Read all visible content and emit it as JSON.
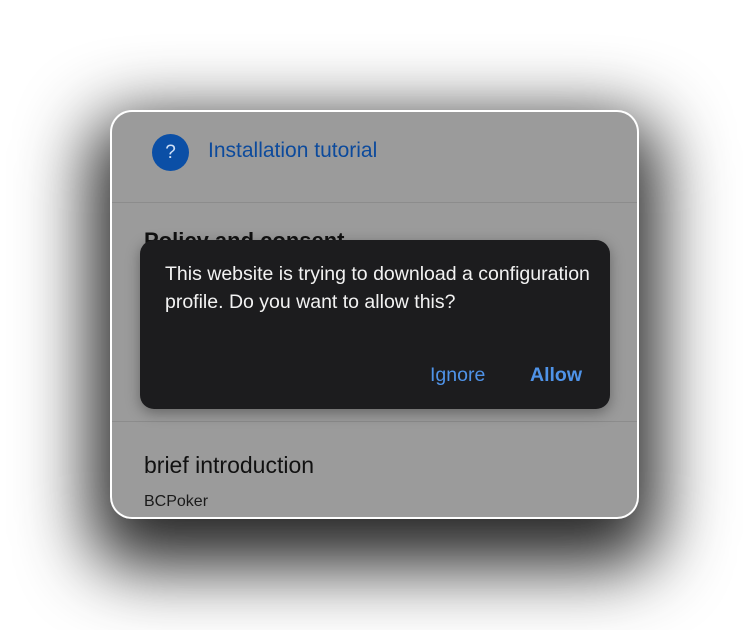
{
  "page": {
    "tutorial_link": {
      "icon": "question-mark-icon",
      "icon_glyph": "?",
      "label": "Installation tutorial",
      "color": "#0c4a9c"
    },
    "obscured_heading": "Policy and consent",
    "intro": {
      "title": "brief introduction",
      "body": "BCPoker"
    }
  },
  "dialog": {
    "message": "This website is trying to download a configuration profile. Do you want to allow this?",
    "ignore_label": "Ignore",
    "allow_label": "Allow",
    "button_color": "#4f93e8"
  }
}
